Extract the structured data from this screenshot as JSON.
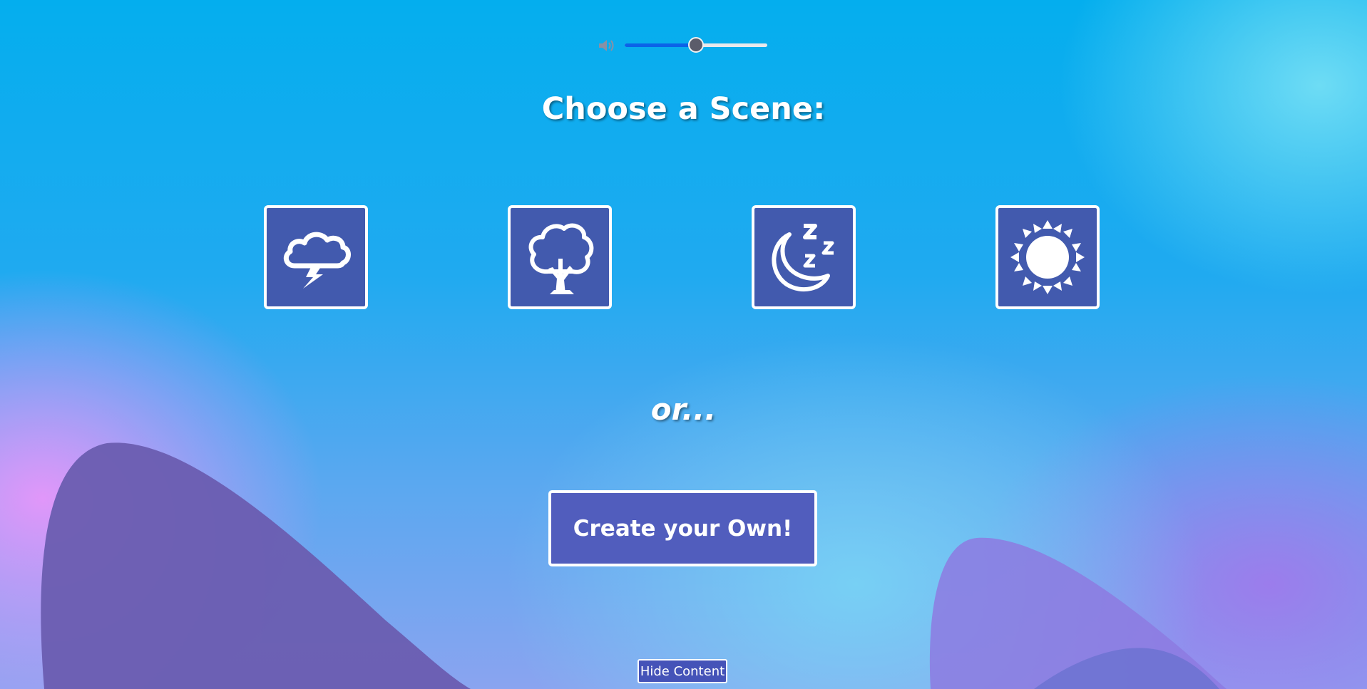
{
  "volume": {
    "icon": "speaker-icon",
    "level": 0.5,
    "fill_color": "#0b63e8"
  },
  "title": "Choose a Scene:",
  "scenes": [
    {
      "icon": "storm-cloud-icon"
    },
    {
      "icon": "tree-icon"
    },
    {
      "icon": "moon-sleep-icon"
    },
    {
      "icon": "sun-icon"
    }
  ],
  "or_text": "or...",
  "create_button": {
    "label": "Create your Own!"
  },
  "hide_button": {
    "label": "Hide Content"
  },
  "colors": {
    "tile_background": "#425aae",
    "button_background": "#515dbd",
    "sky_top": "#04aeee",
    "accent_pink": "#e896fa",
    "accent_purple": "#7a62c8"
  }
}
